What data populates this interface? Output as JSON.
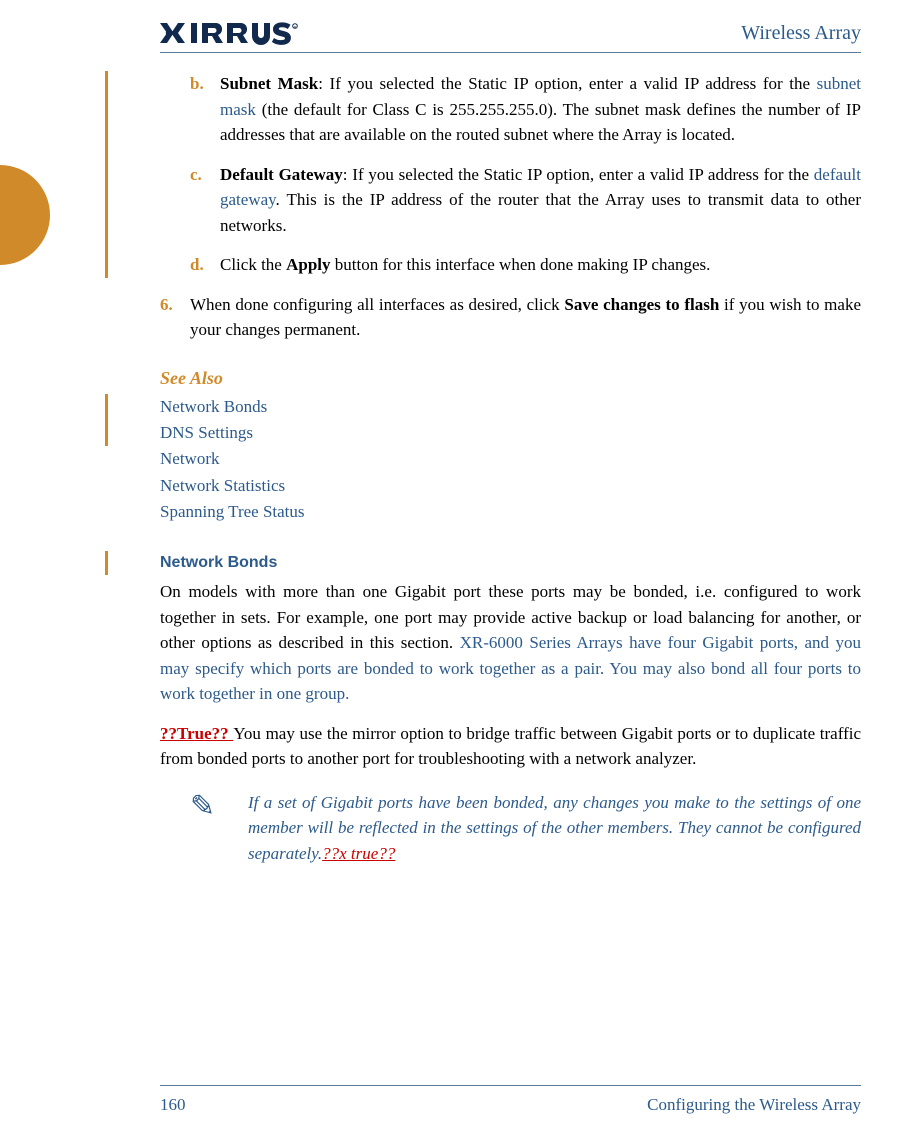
{
  "header": {
    "doc_title": "Wireless Array"
  },
  "items": {
    "b": {
      "marker": "b.",
      "title": "Subnet Mask",
      "pre_link": ": If you selected the Static IP option, enter a valid IP address for the ",
      "link": "subnet mask",
      "post_link": " (the default for Class C is 255.255.255.0). The subnet mask defines the number of IP addresses that are available on the routed subnet where the Array is located."
    },
    "c": {
      "marker": "c.",
      "title": "Default Gateway",
      "pre_link": ": If you selected the Static IP option, enter a valid IP address for the ",
      "link": "default gateway",
      "post_link": ". This is the IP address of the router that the Array uses to transmit data to other networks."
    },
    "d": {
      "marker": "d.",
      "pre_bold": "Click the ",
      "bold": "Apply",
      "post_bold": " button for this interface when done making IP changes."
    },
    "six": {
      "marker": "6.",
      "pre_bold": "When done configuring all interfaces as desired, click ",
      "bold": "Save changes to flash",
      "post_bold": " if you wish to make your changes permanent."
    }
  },
  "see_also": {
    "heading": "See Also",
    "links": [
      "Network Bonds",
      "DNS Settings",
      "Network",
      "Network Statistics",
      "Spanning Tree Status"
    ]
  },
  "section": {
    "heading": "Network Bonds",
    "para1_plain": "On models with more than one Gigabit port these ports may be bonded, i.e. configured to work together in sets. For example, one port may provide active backup or load balancing for another, or other options as described in this section. ",
    "para1_note": "XR-6000 Series Arrays have four Gigabit ports, and you may specify which ports are bonded to work together as a pair. You may also bond all four ports to work together in one group.",
    "para2_editorial": "??True?? ",
    "para2_rest": "You may use the mirror option to bridge traffic between Gigabit ports or to duplicate traffic from bonded ports to another port for troubleshooting with a network analyzer."
  },
  "note": {
    "text": "If a set of Gigabit ports have been bonded, any changes you make to the settings of one member will be reflected in the settings of the other members. They cannot be configured separately.",
    "editorial": "??x true??"
  },
  "footer": {
    "page": "160",
    "section": "Configuring the Wireless Array"
  }
}
